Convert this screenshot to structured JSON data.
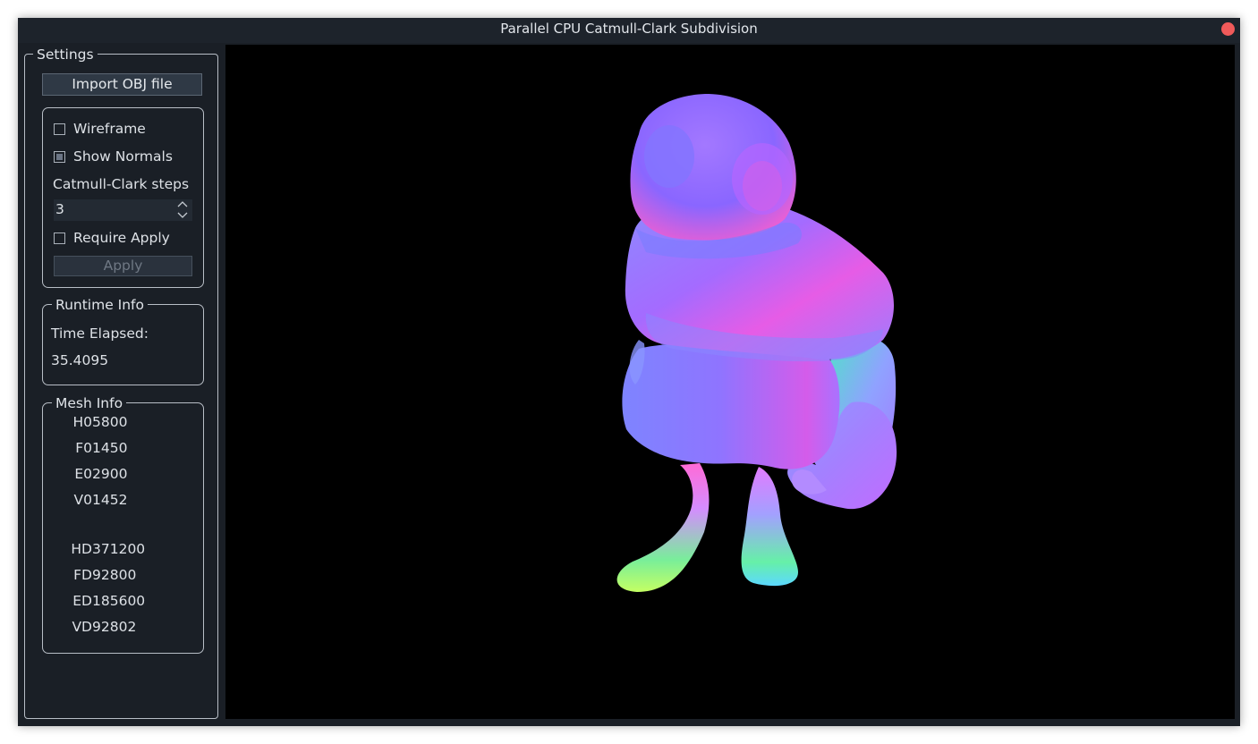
{
  "window": {
    "title": "Parallel CPU Catmull-Clark Subdivision"
  },
  "settings": {
    "legend": "Settings",
    "import_label": "Import OBJ file",
    "wireframe": {
      "label": "Wireframe",
      "checked": false
    },
    "show_normals": {
      "label": "Show Normals",
      "checked": true
    },
    "steps_label": "Catmull-Clark steps",
    "steps_value": "3",
    "require_apply": {
      "label": "Require Apply",
      "checked": false
    },
    "apply_label": "Apply"
  },
  "runtime": {
    "legend": "Runtime Info",
    "time_label": "Time Elapsed:",
    "time_value": "35.4095"
  },
  "mesh": {
    "legend": "Mesh Info",
    "base": [
      {
        "key": "H0",
        "value": "5800"
      },
      {
        "key": "F0",
        "value": "1450"
      },
      {
        "key": "E0",
        "value": "2900"
      },
      {
        "key": "V0",
        "value": "1452"
      }
    ],
    "subdivided": [
      {
        "key": "HD",
        "value": "371200"
      },
      {
        "key": "FD",
        "value": "92800"
      },
      {
        "key": "ED",
        "value": "185600"
      },
      {
        "key": "VD",
        "value": "92802"
      }
    ]
  },
  "colors": {
    "close_button": "#f05a5a",
    "viewport_background": "#000000",
    "normal_shading": [
      "#a26bff",
      "#6f7dff",
      "#ff5fd0",
      "#63f0b0",
      "#c7ff5a",
      "#4ad8ff"
    ]
  }
}
